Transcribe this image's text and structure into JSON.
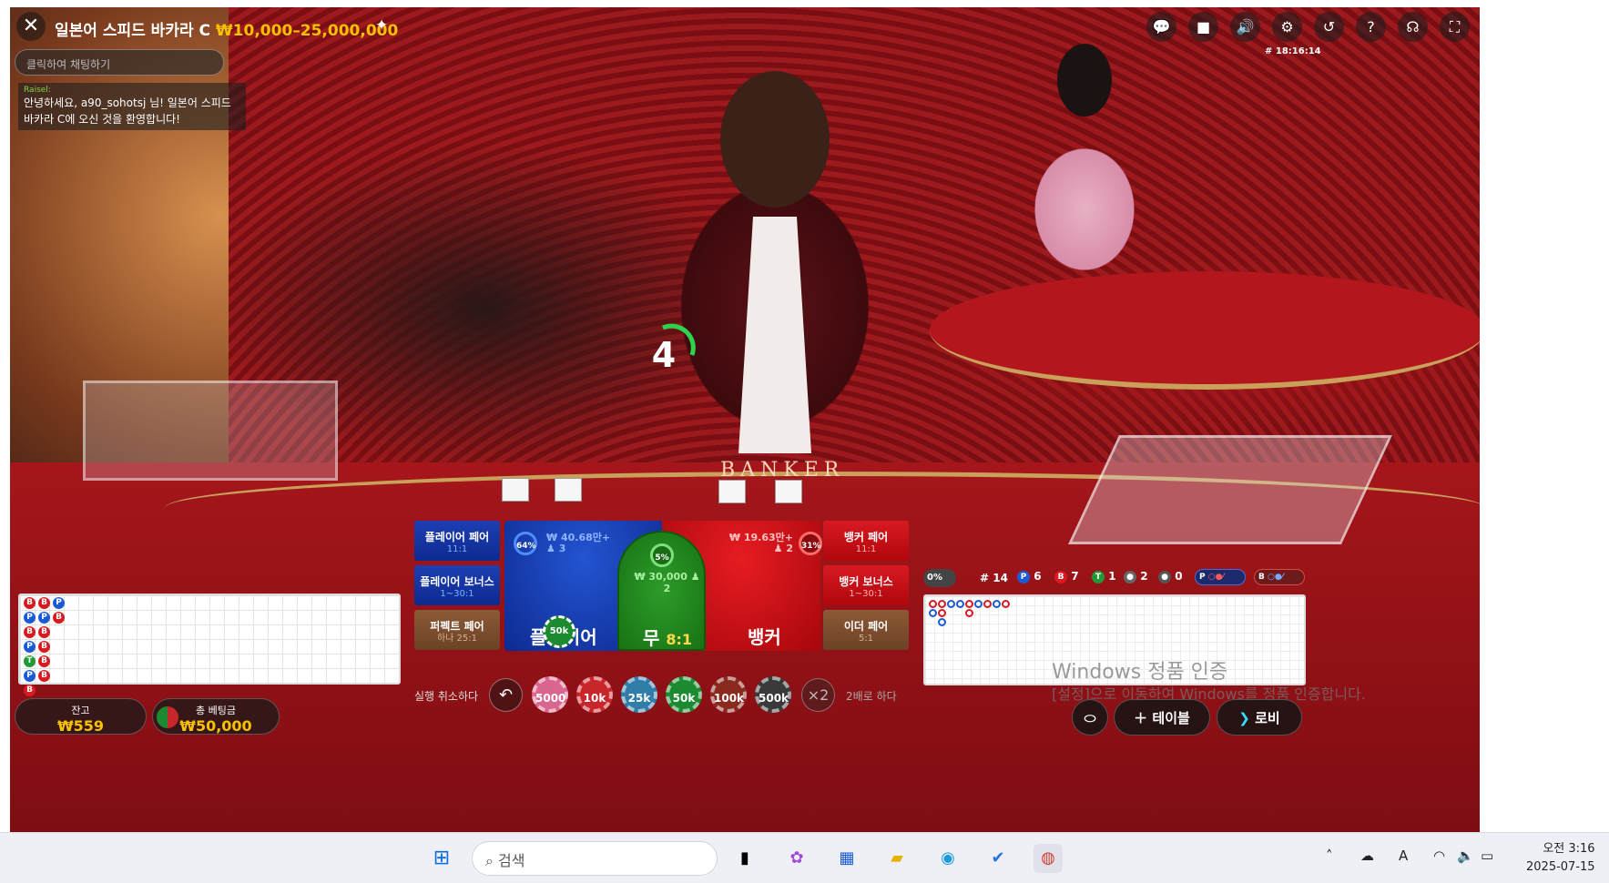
{
  "game": {
    "title": "일본어 스피드 바카라 C",
    "limits": "₩10,000–25,000,000",
    "round_id": "# 18:16:14",
    "countdown": "4"
  },
  "chat": {
    "placeholder": "클릭하여 채팅하기",
    "message_user": "Raisel:",
    "message_text": "안녕하세요, a90_sohotsj 님! 일본어 스피드 바카라 C에 오신 것을 환영합니다!"
  },
  "controls": [
    {
      "name": "chat-icon",
      "glyph": "💬"
    },
    {
      "name": "video-icon",
      "glyph": "■"
    },
    {
      "name": "volume-icon",
      "glyph": "🔊"
    },
    {
      "name": "settings-icon",
      "glyph": "⚙"
    },
    {
      "name": "history-icon",
      "glyph": "↺"
    },
    {
      "name": "help-icon",
      "glyph": "?"
    },
    {
      "name": "support-icon",
      "glyph": "☊"
    },
    {
      "name": "fullscreen-icon",
      "glyph": "⛶"
    }
  ],
  "table_label": "BANKER",
  "side_bets": {
    "player_pair": {
      "label": "플레이어 페어",
      "payout": "11:1"
    },
    "player_bonus": {
      "label": "플레이어 보너스",
      "payout": "1~30:1"
    },
    "perfect_pair": {
      "label": "퍼펙트 페어",
      "payout": "하나 25:1"
    },
    "banker_pair": {
      "label": "뱅커 페어",
      "payout": "11:1"
    },
    "banker_bonus": {
      "label": "뱅커 보너스",
      "payout": "1~30:1"
    },
    "either_pair": {
      "label": "이더 페어",
      "payout": "5:1"
    }
  },
  "main_bets": {
    "player": {
      "label": "플레이어",
      "amount": "₩ 40.68만+",
      "players": "3",
      "percent": "64%"
    },
    "tie": {
      "label": "무",
      "payout": "8:1",
      "amount": "₩ 30,000",
      "players": "2",
      "percent": "5%"
    },
    "banker": {
      "label": "뱅커",
      "amount": "₩ 19.63만+",
      "players": "2",
      "percent": "31%"
    }
  },
  "placed_chip": "50k",
  "chip_row": {
    "undo_label": "실행 취소하다",
    "double_symbol": "×2",
    "double_label": "2배로 하다",
    "chips": [
      {
        "label": "5000",
        "color": "#d9668f"
      },
      {
        "label": "10k",
        "color": "#c8262b"
      },
      {
        "label": "25k",
        "color": "#2f7da8"
      },
      {
        "label": "50k",
        "color": "#1b8a30"
      },
      {
        "label": "100k",
        "color": "#8a2a1f"
      },
      {
        "label": "500k",
        "color": "#3a3a3a"
      }
    ]
  },
  "bead_road": [
    [
      "B",
      "P",
      "B",
      "P",
      "T",
      "P",
      "B"
    ],
    [
      "B",
      "P",
      "B",
      "B",
      "B",
      "B"
    ],
    [
      "P",
      "B"
    ]
  ],
  "stats": {
    "percent": "0%",
    "round": "# 14",
    "player": "6",
    "banker": "7",
    "tie": "1",
    "player_pair": "2",
    "banker_pair": "0",
    "predict_p": "P",
    "predict_b": "B"
  },
  "balance": {
    "label": "잔고",
    "value": "₩559"
  },
  "total_bet": {
    "label": "총 베팅금",
    "value": "₩50,000"
  },
  "watermark": {
    "line1": "Windows 정품 인증",
    "line2": "[설정]으로 이동하여 Windows를 정품 인증합니다."
  },
  "bottom_buttons": {
    "table_label": "테이블",
    "lobby_label": "로비"
  },
  "taskbar": {
    "search_placeholder": "검색",
    "time": "오전 3:16",
    "date": "2025-07-15",
    "apps": [
      "start-icon",
      "file-explorer-taskview-icon",
      "copilot-icon",
      "store-icon",
      "folder-icon",
      "edge-icon",
      "todo-icon",
      "chrome-icon"
    ]
  }
}
